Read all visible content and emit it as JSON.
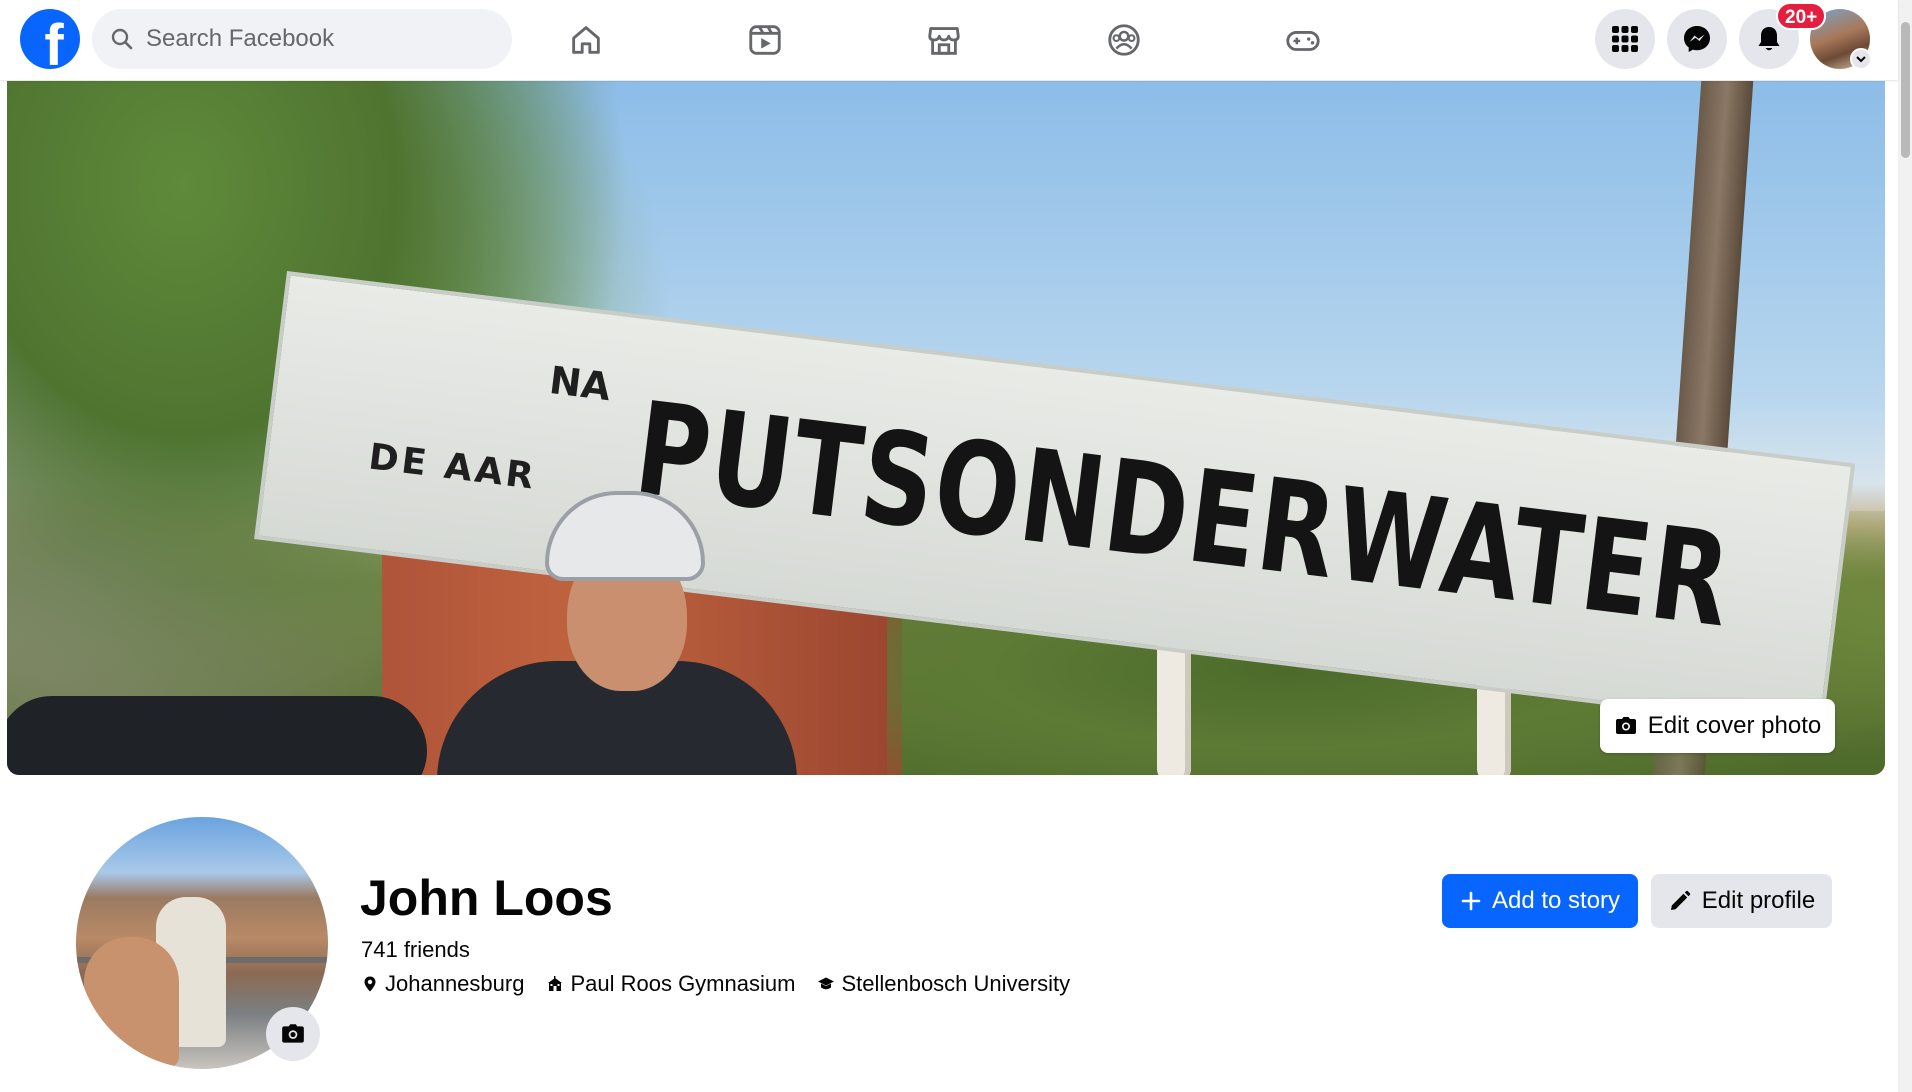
{
  "topbar": {
    "logo_letter": "f",
    "search": {
      "placeholder": "Search Facebook",
      "value": ""
    },
    "nav_icons": [
      "home-icon",
      "video-icon",
      "marketplace-icon",
      "groups-icon",
      "gaming-icon"
    ],
    "right_icons": [
      "menu-grid-icon",
      "messenger-icon",
      "notifications-icon"
    ],
    "notifications_badge": "20+"
  },
  "cover": {
    "sign": {
      "line1": "NA",
      "line2": "DE AAR",
      "main": "PUTSONDERWATER"
    },
    "edit_label": "Edit cover photo"
  },
  "profile": {
    "name": "John Loos",
    "friends": "741 friends",
    "details": [
      {
        "icon": "location-pin-icon",
        "text": "Johannesburg"
      },
      {
        "icon": "school-icon",
        "text": "Paul Roos Gymnasium"
      },
      {
        "icon": "graduation-cap-icon",
        "text": "Stellenbosch University"
      }
    ]
  },
  "actions": {
    "add_story": "Add to story",
    "edit_profile": "Edit profile"
  },
  "colors": {
    "brand": "#0866ff",
    "badge": "#e41e3f",
    "button_gray": "#e4e6eb",
    "search_bg": "#f0f2f5"
  }
}
